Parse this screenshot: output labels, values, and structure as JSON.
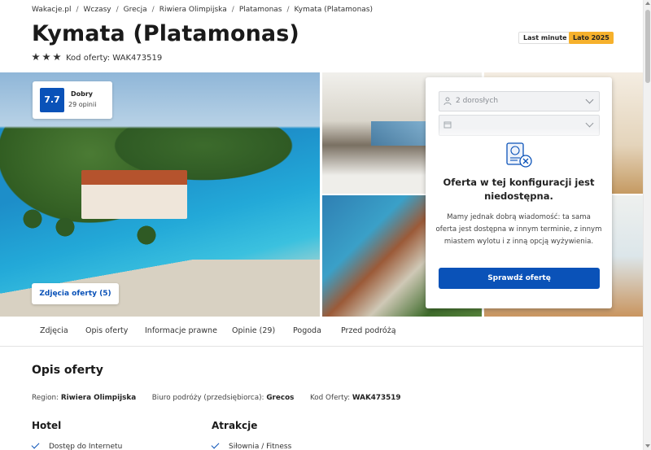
{
  "breadcrumb": [
    "Wakacje.pl",
    "Wczasy",
    "Grecja",
    "Riwiera Olimpijska",
    "Platamonas",
    "Kymata (Platamonas)"
  ],
  "hotel": {
    "title": "Kymata (Platamonas)",
    "stars": 3,
    "offer_code_line": "Kod oferty: WAK473519"
  },
  "tags": {
    "last_minute": "Last minute",
    "season": "Lato 2025",
    "season_color": "#f6b12c"
  },
  "rating": {
    "score": "7.7",
    "label": "Dobry",
    "count": "29 opinii"
  },
  "gallery": {
    "photos_button": "Zdjęcia oferty (5)"
  },
  "offer_panel": {
    "participants_value": "2 dorosłych",
    "date_value": "",
    "participants_icon": "person-icon",
    "date_icon": "calendar-icon",
    "unavailable_title": "Oferta w tej konfiguracji jest niedostępna.",
    "unavailable_text": "Mamy jednak dobrą wiadomość: ta sama oferta jest dostępna w innym terminie, z innym miastem wylotu i z inną opcją wyżywienia.",
    "check_button": "Sprawdź ofertę",
    "accent_color": "#0a52b8"
  },
  "tabs": [
    "Zdjęcia",
    "Opis oferty",
    "Informacje prawne",
    "Opinie (29)",
    "Pogoda",
    "Przed podróżą"
  ],
  "description": {
    "title": "Opis oferty",
    "region_label": "Region:",
    "region_value": "Riwiera Olimpijska",
    "operator_label": "Biuro podróży (przedsiębiorca):",
    "operator_value": "Grecos",
    "code_label": "Kod Oferty:",
    "code_value": "WAK473519"
  },
  "columns": {
    "hotel_title": "Hotel",
    "hotel_first_item": "Dostęp do Internetu",
    "attractions_title": "Atrakcje",
    "attractions_first_item": "Siłownia / Fitness"
  }
}
